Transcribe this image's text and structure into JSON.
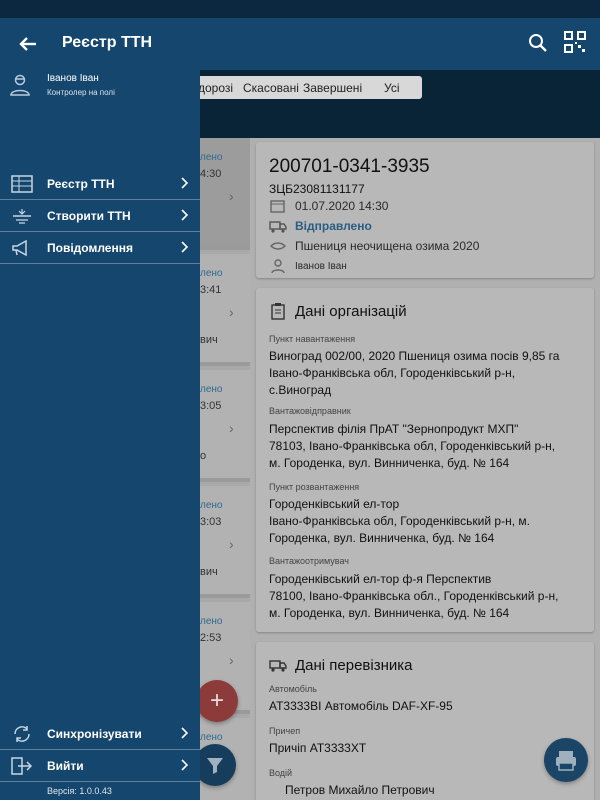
{
  "appbar": {
    "title": "Реєстр ТТН"
  },
  "tabs": [
    "дорозі",
    "Скасовані",
    "Завершені",
    "Усі"
  ],
  "list_items": [
    {
      "status": "лено",
      "time": "4:30",
      "name": ""
    },
    {
      "status": "лено",
      "time": "3:41",
      "name": "вич"
    },
    {
      "status": "лено",
      "time": "3:05",
      "name": "о"
    },
    {
      "status": "лено",
      "time": "3:03",
      "name": "вич"
    },
    {
      "status": "лено",
      "time": "2:53",
      "name": ""
    },
    {
      "status": "лено",
      "time": "",
      "name": ""
    }
  ],
  "detail": {
    "number": "200701-0341-3935",
    "code": "ЗЦБ23081131177",
    "datetime": "01.07.2020 14:30",
    "status": "Відправлено",
    "cargo": "Пшениця неочищена озима 2020",
    "person": "Іванов Іван"
  },
  "org": {
    "title": "Дані організацій",
    "fields": [
      {
        "label": "Пункт навантаження",
        "lines": [
          "Виноград 002/00, 2020 Пшениця озима посів 9,85 га",
          "Івано-Франківська обл, Городенківський р-н,",
          "с.Виноград"
        ]
      },
      {
        "label": "Вантажовідправник",
        "lines": [
          "Перспектив філія ПрАТ \"Зернопродукт МХП\"",
          "78103, Івано-Франківська обл, Городенківський р-н,",
          "м. Городенка, вул. Винниченка, буд. № 164"
        ]
      },
      {
        "label": "Пункт розвантаження",
        "lines": [
          "Городенківський ел-тор",
          "Івано-Франківська обл, Городенківський р-н, м.",
          "Городенка, вул. Винниченка, буд. № 164"
        ]
      },
      {
        "label": "Вантажоотримувач",
        "lines": [
          "Городенківський ел-тор ф-я Перспектив",
          "78100, Івано-Франківська обл., Городенківський р-н,",
          "м. Городенка, вул. Винниченка, буд. № 164"
        ]
      }
    ]
  },
  "carrier": {
    "title": "Дані перевізника",
    "vehicle_label": "Автомобіль",
    "vehicle": "АТ3333ВІ Автомобіль DAF-XF-95",
    "trailer_label": "Причеп",
    "trailer": "Причіп АТ3333ХТ",
    "driver_label": "Водій",
    "driver": "Петров  Михайло Петрович"
  },
  "fab": {
    "add": "+"
  },
  "drawer": {
    "title": "Реєстр ТТН",
    "user_name": "Іванов Іван",
    "user_role": "Контролер на полі",
    "menu": [
      {
        "label": "Реєстр ТТН",
        "icon": "registry-icon"
      },
      {
        "label": "Створити ТТН",
        "icon": "field-icon"
      },
      {
        "label": "Повідомлення",
        "icon": "megaphone-icon"
      }
    ],
    "bottom_menu": [
      {
        "label": "Синхронізувати",
        "icon": "sync-icon"
      },
      {
        "label": "Вийти",
        "icon": "logout-icon"
      }
    ],
    "version": "Версія: 1.0.0.43"
  }
}
